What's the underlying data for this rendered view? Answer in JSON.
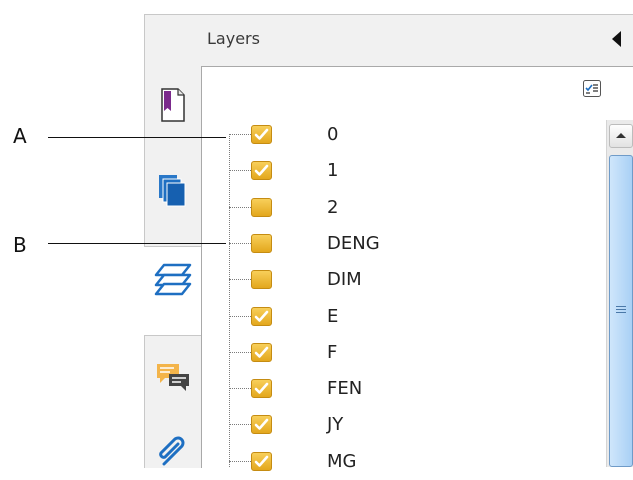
{
  "panel": {
    "title": "Layers"
  },
  "callouts": [
    {
      "letter": "A"
    },
    {
      "letter": "B"
    }
  ],
  "layers": [
    {
      "name": "0",
      "visible": true
    },
    {
      "name": "1",
      "visible": true
    },
    {
      "name": "2",
      "visible": false
    },
    {
      "name": "DENG",
      "visible": false
    },
    {
      "name": "DIM",
      "visible": false
    },
    {
      "name": "E",
      "visible": true
    },
    {
      "name": "F",
      "visible": true
    },
    {
      "name": "FEN",
      "visible": true
    },
    {
      "name": "JY",
      "visible": true
    },
    {
      "name": "MG",
      "visible": true
    }
  ],
  "nav_icons": [
    "bookmarks-icon",
    "pages-icon",
    "layers-icon",
    "comments-icon",
    "attachments-icon"
  ],
  "icons": {
    "options": "layer-options-icon",
    "collapse": "collapse-arrow-icon"
  },
  "colors": {
    "checkbox_fill": "#f2bb3b",
    "checkbox_border": "#c58c12",
    "accent_blue": "#1e6fc2",
    "scroll_thumb": "#a9d0f5"
  }
}
